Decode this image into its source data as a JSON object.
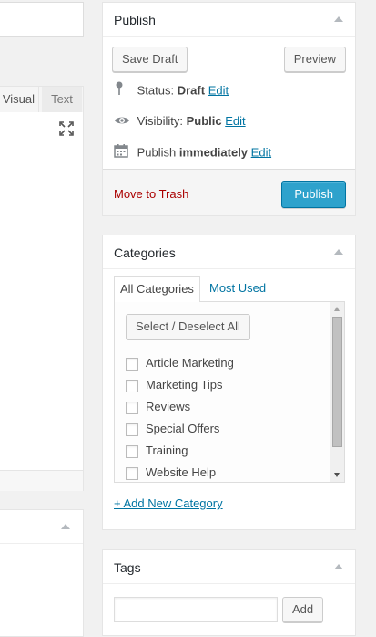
{
  "editor": {
    "tab_visual": "Visual",
    "tab_text": "Text"
  },
  "publish": {
    "title": "Publish",
    "save_draft": "Save Draft",
    "preview": "Preview",
    "status_label": "Status:",
    "status_value": "Draft",
    "status_edit": "Edit",
    "visibility_label": "Visibility:",
    "visibility_value": "Public",
    "visibility_edit": "Edit",
    "publish_label": "Publish",
    "publish_value": "immediately",
    "publish_edit": "Edit",
    "move_to_trash": "Move to Trash",
    "publish_button": "Publish"
  },
  "categories": {
    "title": "Categories",
    "tab_all": "All Categories",
    "tab_most_used": "Most Used",
    "select_deselect": "Select / Deselect All",
    "items": [
      "Article Marketing",
      "Marketing Tips",
      "Reviews",
      "Special Offers",
      "Training",
      "Website Help"
    ],
    "add_new": "+ Add New Category"
  },
  "tags": {
    "title": "Tags",
    "input_value": "",
    "add_button": "Add"
  },
  "icons": {
    "status": "pin-icon",
    "visibility": "eye-icon",
    "schedule": "calendar-icon",
    "fullscreen": "expand-icon",
    "toggle": "arrow-up-icon"
  },
  "colors": {
    "accent": "#2ea2cc",
    "link": "#0074a2",
    "trash": "#a00"
  }
}
